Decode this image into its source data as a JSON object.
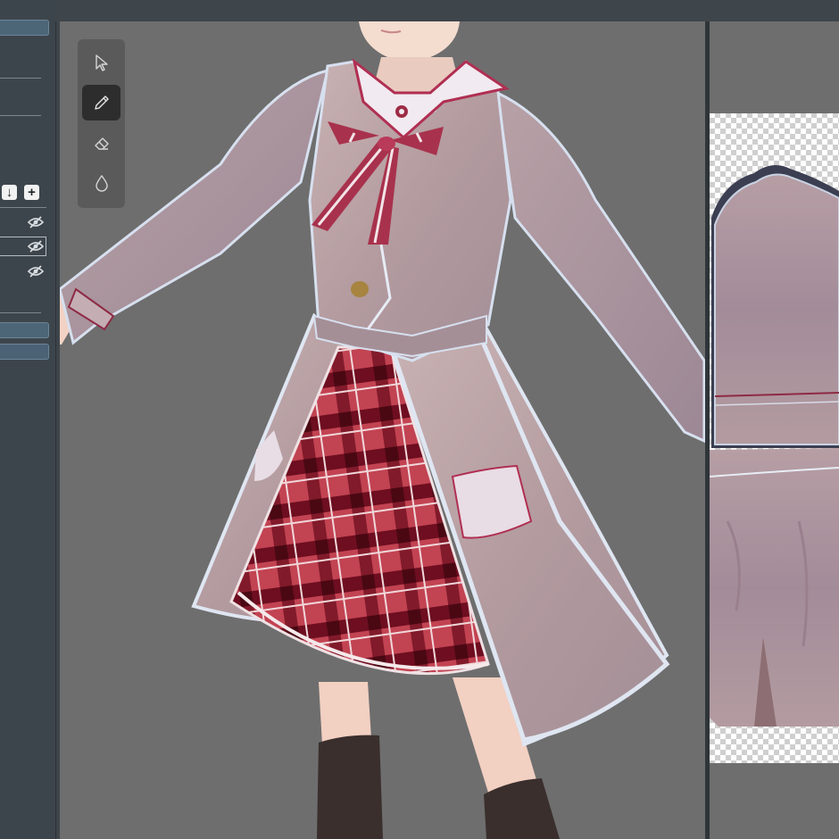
{
  "layers_panel": {
    "move_down_glyph": "↓",
    "add_glyph": "+",
    "layers": [
      {
        "visible": false,
        "selected": false
      },
      {
        "visible": false,
        "selected": true
      },
      {
        "visible": false,
        "selected": false
      }
    ]
  },
  "tools": [
    {
      "name": "select",
      "icon": "cursor-arrow-icon",
      "active": false
    },
    {
      "name": "pen",
      "icon": "pencil-icon",
      "active": true
    },
    {
      "name": "eraser",
      "icon": "eraser-icon",
      "active": false
    },
    {
      "name": "fill",
      "icon": "droplet-icon",
      "active": false
    }
  ],
  "colors": {
    "panel_bg": "#3d454c",
    "panel_bar": "#4d6677",
    "viewport_bg": "#6e6e6e",
    "palette_bg": "#585858",
    "active_tool": "#2d2d2d",
    "coat": "#bba3a5",
    "skirt_red": "#c1414f",
    "ribbon": "#a8324d"
  }
}
